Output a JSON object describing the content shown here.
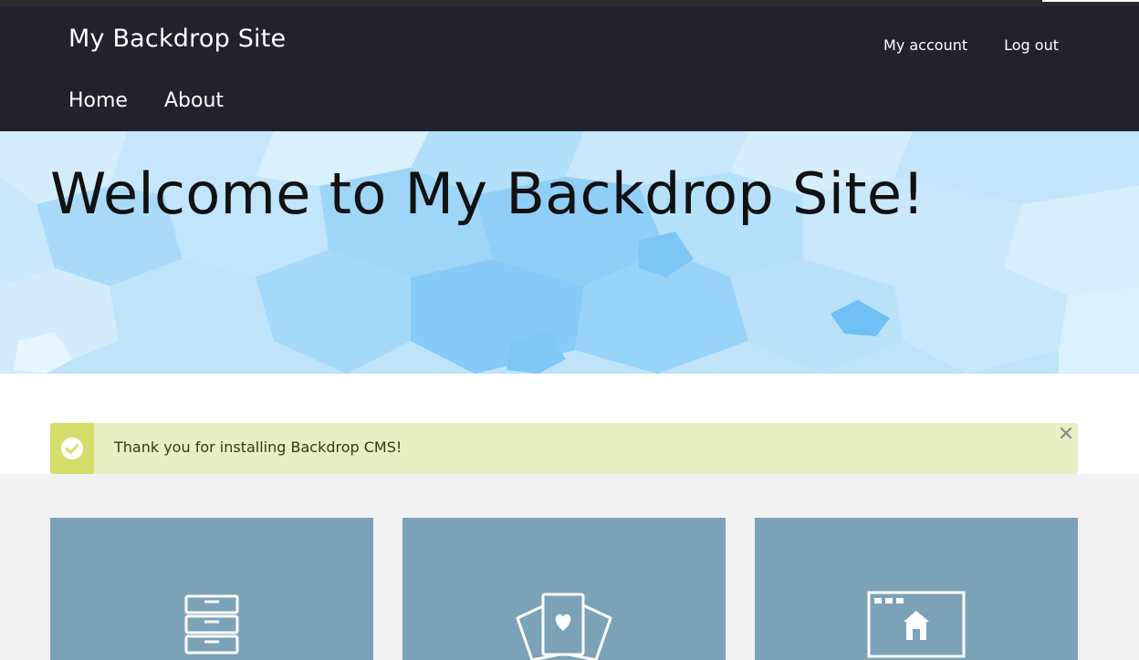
{
  "header": {
    "site_name": "My Backdrop Site",
    "account_menu": [
      {
        "label": "My account"
      },
      {
        "label": "Log out"
      }
    ],
    "main_menu": [
      {
        "label": "Home"
      },
      {
        "label": "About"
      }
    ]
  },
  "hero": {
    "title": "Welcome to My Backdrop Site!"
  },
  "message": {
    "text": "Thank you for installing Backdrop CMS!",
    "type": "status",
    "icon": "check-circle-icon",
    "close_icon": "close-icon"
  },
  "cards": [
    {
      "icon": "file-cabinet-icon"
    },
    {
      "icon": "cards-heart-icon"
    },
    {
      "icon": "browser-home-icon"
    }
  ],
  "colors": {
    "header_bg": "#20232d",
    "hero_bg": "#b9e2fa",
    "message_bg": "#e8efc3",
    "message_accent": "#d4df6b",
    "card_bg": "#7ba2b7"
  }
}
